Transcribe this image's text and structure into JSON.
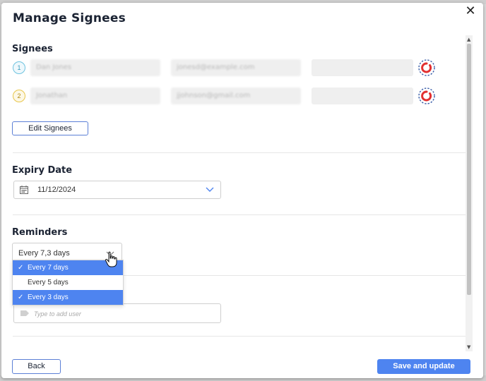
{
  "modal": {
    "title": "Manage Signees",
    "close_glyph": "✕"
  },
  "signees": {
    "heading": "Signees",
    "rows": [
      {
        "number": "1",
        "name": "Dan Jones",
        "email": "jonesd@example.com",
        "extra": ""
      },
      {
        "number": "2",
        "name": "Jonathan",
        "email": "jjohnson@gmail.com",
        "extra": ""
      }
    ],
    "edit_button": "Edit Signees",
    "status_icon": "signature-status-icon"
  },
  "expiry": {
    "heading": "Expiry Date",
    "value": "11/12/2024",
    "icon": "calendar-icon"
  },
  "reminders": {
    "heading": "Reminders",
    "selected": "Every 7,3 days",
    "options": [
      {
        "label": "Every 7 days",
        "selected": true
      },
      {
        "label": "Every 5 days",
        "selected": false
      },
      {
        "label": "Every 3 days",
        "selected": true
      }
    ],
    "check_glyph": "✓"
  },
  "cc": {
    "placeholder": "Type to add user",
    "icon": "tag-icon"
  },
  "footer": {
    "back_label": "Back",
    "save_label": "Save and update"
  },
  "colors": {
    "accent": "#4e84f0",
    "outline": "#5b7fd6",
    "status_red": "#e23030",
    "status_blue": "#3a5ea8"
  }
}
